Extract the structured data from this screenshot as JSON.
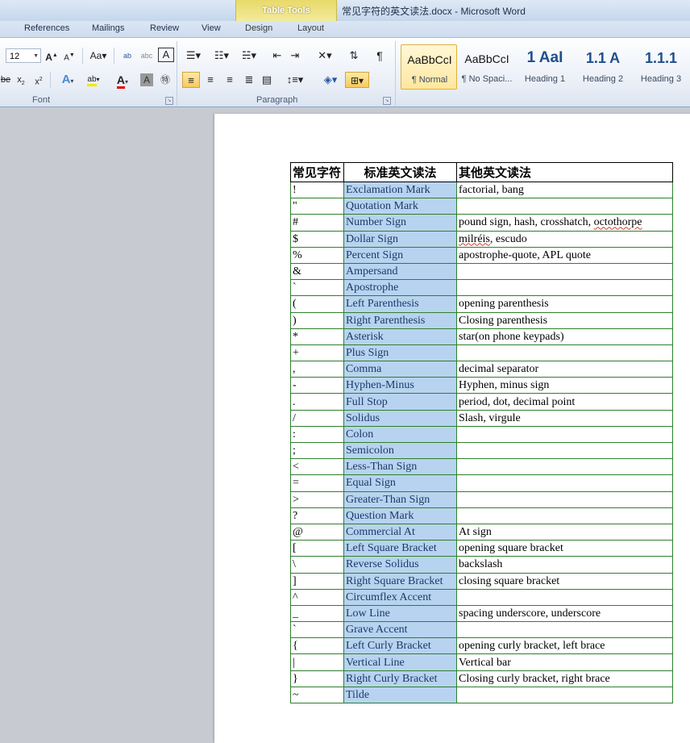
{
  "window": {
    "title": "常见字符的英文读法.docx  -  Microsoft Word"
  },
  "contextual": {
    "group_label": "Table Tools"
  },
  "tabs": [
    "References",
    "Mailings",
    "Review",
    "View",
    "Design",
    "Layout"
  ],
  "ribbon": {
    "font_size": "12",
    "font_group_label": "Font",
    "paragraph_group_label": "Paragraph",
    "styles": [
      {
        "preview": "AaBbCcI",
        "label": "¶ Normal"
      },
      {
        "preview": "AaBbCcI",
        "label": "¶ No Spaci..."
      },
      {
        "preview": "1  AaI",
        "label": "Heading 1"
      },
      {
        "preview": "1.1  A",
        "label": "Heading 2"
      },
      {
        "preview": "1.1.1",
        "label": "Heading 3"
      }
    ]
  },
  "table": {
    "headers": [
      "常见字符",
      "标准英文读法",
      "其他英文读法"
    ],
    "rows": [
      {
        "char": "!",
        "standard": "Exclamation Mark",
        "other": "factorial, bang"
      },
      {
        "char": "\"",
        "standard": "Quotation Mark",
        "other": ""
      },
      {
        "char": "#",
        "standard": "Number Sign",
        "other": "pound sign, hash, crosshatch, octothorpe"
      },
      {
        "char": "$",
        "standard": "Dollar Sign",
        "other": "milréis, escudo"
      },
      {
        "char": "%",
        "standard": "Percent Sign",
        "other": "apostrophe-quote, APL quote"
      },
      {
        "char": "&",
        "standard": "Ampersand",
        "other": ""
      },
      {
        "char": "`",
        "standard": "Apostrophe",
        "other": ""
      },
      {
        "char": "(",
        "standard": "Left Parenthesis",
        "other": "opening parenthesis"
      },
      {
        "char": ")",
        "standard": "Right Parenthesis",
        "other": "Closing parenthesis"
      },
      {
        "char": "*",
        "standard": "Asterisk",
        "other": "star(on phone keypads)"
      },
      {
        "char": "+",
        "standard": "Plus Sign",
        "other": ""
      },
      {
        "char": ",",
        "standard": "Comma",
        "other": "decimal separator"
      },
      {
        "char": "-",
        "standard": "Hyphen-Minus",
        "other": "Hyphen, minus sign"
      },
      {
        "char": ".",
        "standard": "Full Stop",
        "other": "period, dot, decimal point"
      },
      {
        "char": "/",
        "standard": "Solidus",
        "other": "Slash, virgule"
      },
      {
        "char": ":",
        "standard": "Colon",
        "other": ""
      },
      {
        "char": ";",
        "standard": "Semicolon",
        "other": ""
      },
      {
        "char": "<",
        "standard": "Less-Than Sign",
        "other": ""
      },
      {
        "char": "=",
        "standard": "Equal Sign",
        "other": ""
      },
      {
        "char": ">",
        "standard": "Greater-Than Sign",
        "other": ""
      },
      {
        "char": "?",
        "standard": "Question Mark",
        "other": ""
      },
      {
        "char": "@",
        "standard": "Commercial At",
        "other": "At sign"
      },
      {
        "char": "[",
        "standard": "Left Square Bracket",
        "other": "opening square bracket"
      },
      {
        "char": "\\",
        "standard": "Reverse Solidus",
        "other": "backslash"
      },
      {
        "char": "]",
        "standard": "Right Square Bracket",
        "other": "closing square bracket"
      },
      {
        "char": "^",
        "standard": "Circumflex Accent",
        "other": ""
      },
      {
        "char": "_",
        "standard": "Low Line",
        "other": "spacing underscore, underscore"
      },
      {
        "char": "`",
        "standard": "Grave Accent",
        "other": ""
      },
      {
        "char": "{",
        "standard": "Left Curly Bracket",
        "other": "opening curly bracket, left brace"
      },
      {
        "char": "|",
        "standard": "Vertical Line",
        "other": "Vertical bar"
      },
      {
        "char": "}",
        "standard": "Right Curly Bracket",
        "other": "Closing curly bracket, right brace"
      },
      {
        "char": "~",
        "standard": "Tilde",
        "other": ""
      }
    ]
  },
  "colors": {
    "standard_column_bg": "#b8d3ef",
    "table_border": "#2f7f2f",
    "contextual_tab": "#e8d96a"
  }
}
